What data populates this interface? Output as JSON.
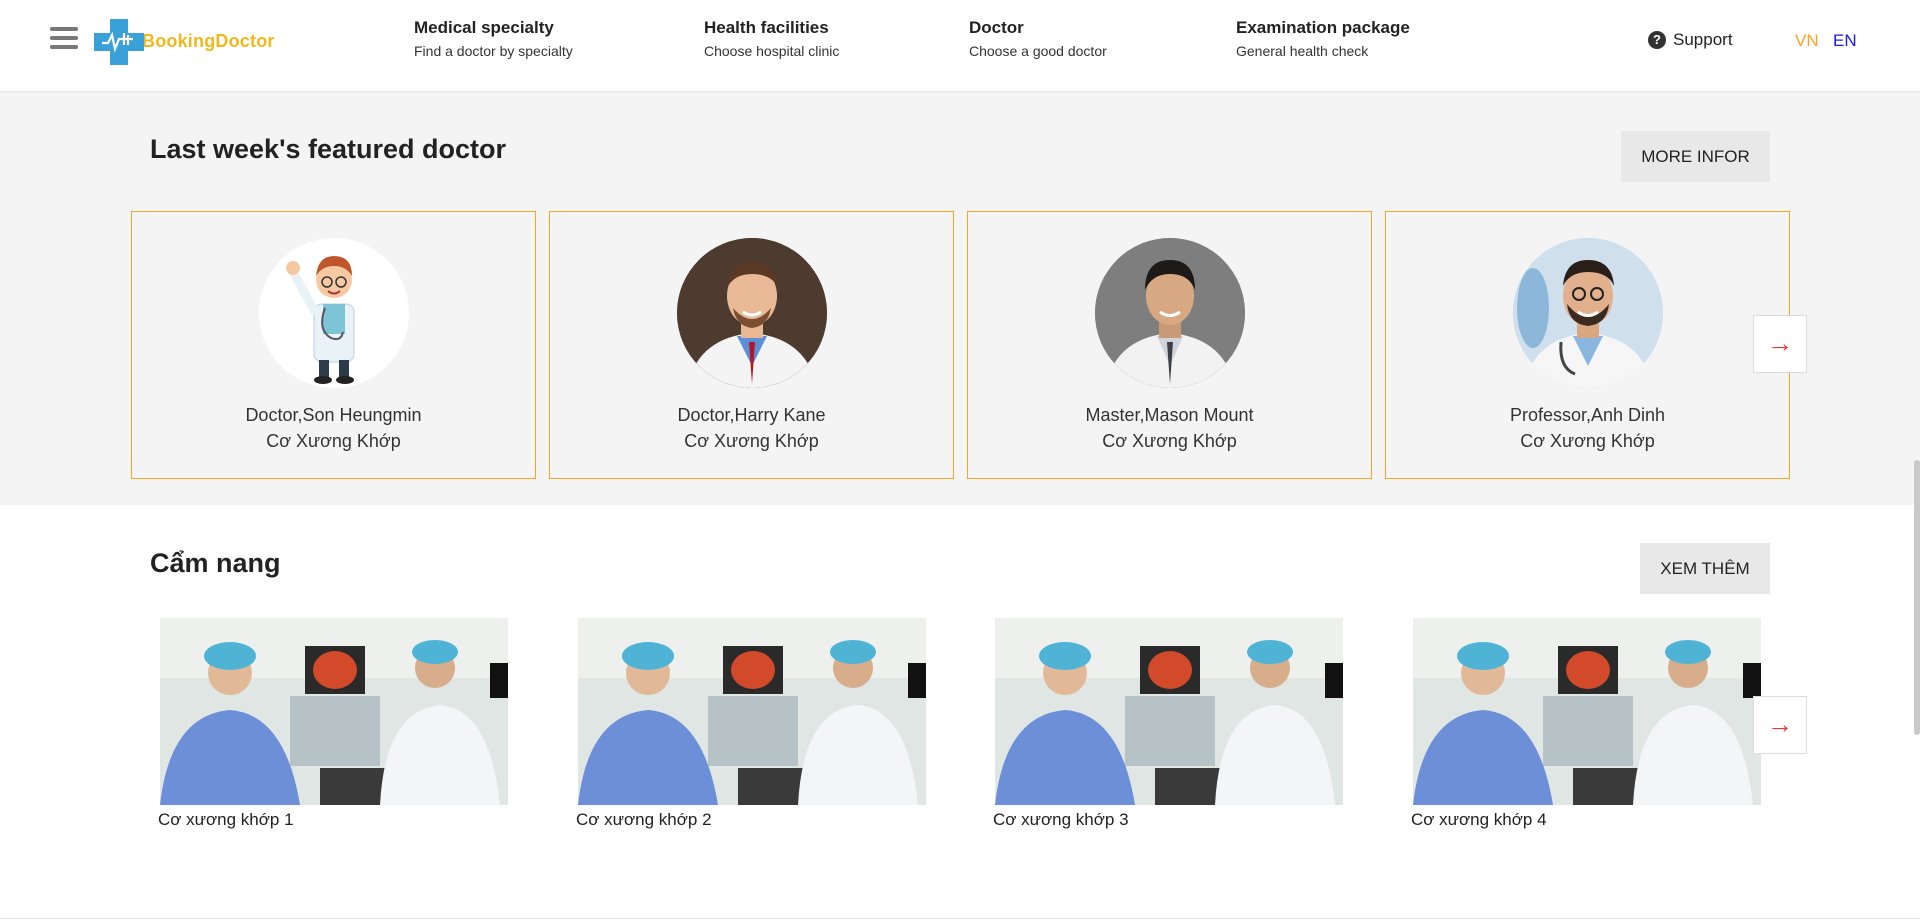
{
  "header": {
    "logo_text": "BookingDoctor",
    "nav": [
      {
        "title": "Medical specialty",
        "sub": "Find a doctor by specialty"
      },
      {
        "title": "Health facilities",
        "sub": "Choose hospital clinic"
      },
      {
        "title": "Doctor",
        "sub": "Choose a good doctor"
      },
      {
        "title": "Examination package",
        "sub": "General health check"
      }
    ],
    "support_label": "Support",
    "lang_vn": "VN",
    "lang_en": "EN"
  },
  "featured": {
    "title": "Last week's featured doctor",
    "more_label": "MORE INFOR",
    "doctors": [
      {
        "name": "Doctor,Son Heungmin",
        "specialty": "Cơ Xương Khớp"
      },
      {
        "name": "Doctor,Harry Kane",
        "specialty": "Cơ Xương Khớp"
      },
      {
        "name": "Master,Mason Mount",
        "specialty": "Cơ Xương Khớp"
      },
      {
        "name": "Professor,Anh Dinh",
        "specialty": "Cơ Xương Khớp"
      }
    ],
    "next_arrow": "→"
  },
  "handbook": {
    "title": "Cẩm nang",
    "more_label": "XEM THÊM",
    "items": [
      {
        "caption": "Cơ xương khớp 1"
      },
      {
        "caption": "Cơ xương khớp 2"
      },
      {
        "caption": "Cơ xương khớp 3"
      },
      {
        "caption": "Cơ xương khớp 4"
      }
    ],
    "next_arrow": "→"
  },
  "colors": {
    "accent_orange": "#f5a623",
    "lang_vn": "#f5a623",
    "lang_en": "#1a1ae6",
    "arrow_red": "#e53935",
    "logo_blue": "#3aa0d8"
  }
}
